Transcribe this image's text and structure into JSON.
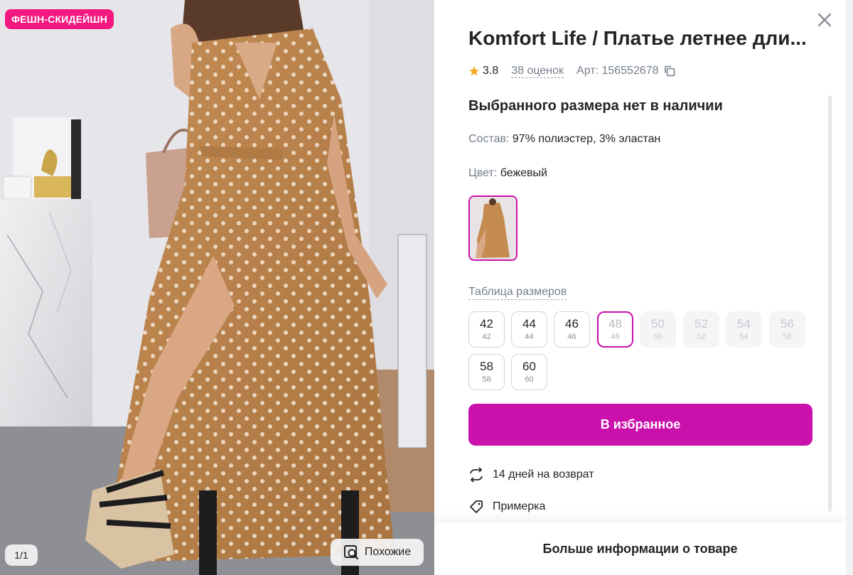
{
  "photo": {
    "badge": "ФЕШН-СКИДЕЙШН",
    "counter": "1/1",
    "similar_label": "Похожие"
  },
  "product": {
    "title": "Komfort Life / Платье летнее дли...",
    "rating": "3.8",
    "reviews": "38 оценок",
    "article": "Арт: 156552678",
    "availability": "Выбранного размера нет в наличии",
    "composition_label": "Состав:",
    "composition_value": "97% полиэстер, 3% эластан",
    "color_label": "Цвет:",
    "color_value": "бежевый",
    "size_table_label": "Таблица размеров",
    "sizes": [
      {
        "ru": "42",
        "sub": "42",
        "state": "available"
      },
      {
        "ru": "44",
        "sub": "44",
        "state": "available"
      },
      {
        "ru": "46",
        "sub": "46",
        "state": "available"
      },
      {
        "ru": "48",
        "sub": "48",
        "state": "selected-unavailable"
      },
      {
        "ru": "50",
        "sub": "50",
        "state": "unavailable"
      },
      {
        "ru": "52",
        "sub": "52",
        "state": "unavailable"
      },
      {
        "ru": "54",
        "sub": "54",
        "state": "unavailable"
      },
      {
        "ru": "56",
        "sub": "56",
        "state": "unavailable"
      },
      {
        "ru": "58",
        "sub": "58",
        "state": "available"
      },
      {
        "ru": "60",
        "sub": "60",
        "state": "available"
      }
    ],
    "favorite_button": "В избранное",
    "features": [
      {
        "icon": "return-arrows-icon",
        "label": "14 дней на возврат"
      },
      {
        "icon": "tag-icon",
        "label": "Примерка"
      }
    ],
    "more_info": "Больше информации о товаре"
  },
  "colors": {
    "accent": "#cb11ab",
    "badge": "#f4187f",
    "star": "#f5a623",
    "muted": "#757d8a"
  }
}
